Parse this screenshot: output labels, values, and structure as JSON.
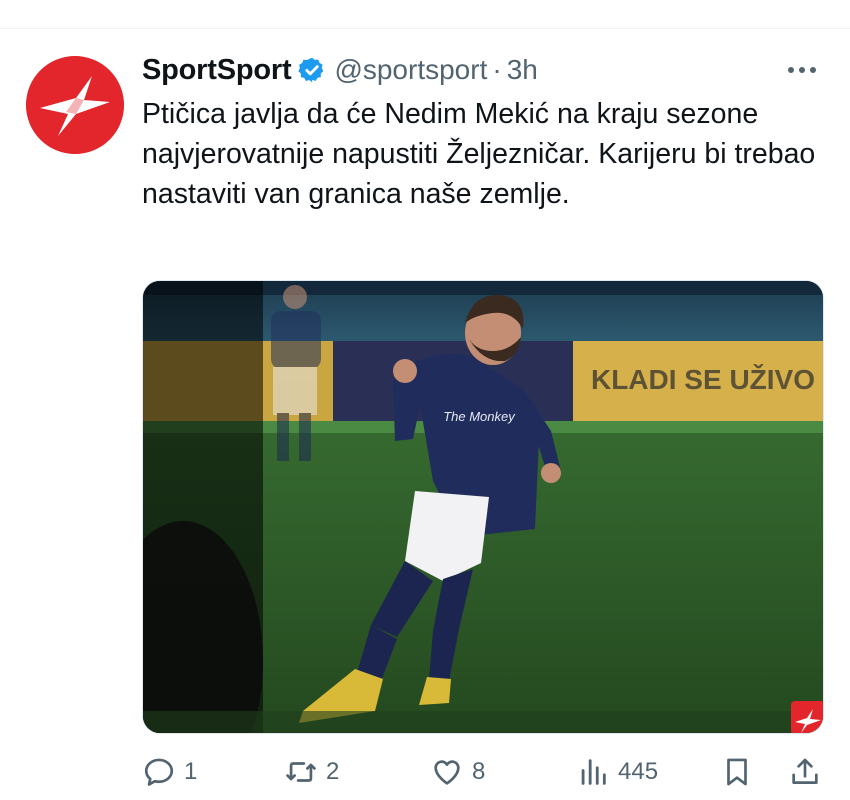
{
  "tweet": {
    "display_name": "SportSport",
    "handle": "@sportsport",
    "separator": "·",
    "time": "3h",
    "text": "Ptičica javlja da će Nedim Mekić na kraju sezone najvjerovatnije napustiti Željezničar. Karijeru bi trebao nastaviti van granica naše zemlje.",
    "media": {
      "description_icon": "photo",
      "board_text": "KLADI SE UŽIVO",
      "shirt_text": "The Monkey"
    },
    "actions": {
      "replies": "1",
      "reposts": "2",
      "likes": "8",
      "views": "445"
    }
  },
  "icons": {
    "verified": "verified-badge-icon",
    "more": "more-icon",
    "reply": "reply-icon",
    "repost": "repost-icon",
    "like": "heart-icon",
    "views": "views-icon",
    "bookmark": "bookmark-icon",
    "share": "share-icon"
  },
  "colors": {
    "brand_red": "#e3262b",
    "verified_blue": "#1d9bf0",
    "text_primary": "#0f1419",
    "text_secondary": "#536471"
  }
}
